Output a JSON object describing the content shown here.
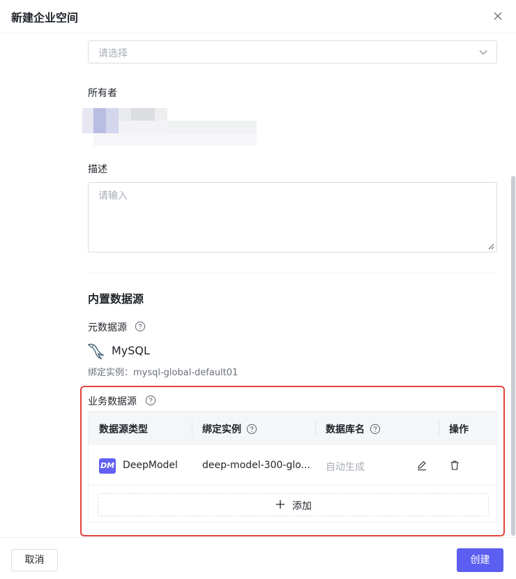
{
  "dialog": {
    "title": "新建企业空间"
  },
  "form": {
    "select_placeholder": "请选择",
    "owner_label": "所有者",
    "description_label": "描述",
    "description_placeholder": "请输入"
  },
  "builtin": {
    "section_title": "内置数据源",
    "meta_label": "元数据源",
    "meta_type": "MySQL",
    "bind_instance": "绑定实例：mysql-global-default01"
  },
  "business": {
    "label": "业务数据源",
    "columns": [
      "数据源类型",
      "绑定实例",
      "数据库名",
      "操作"
    ],
    "rows": [
      {
        "type": "DeepModel",
        "logo": "DM",
        "instance": "deep-model-300-glo...",
        "db_name": "自动生成"
      }
    ],
    "add_label": "添加"
  },
  "footer": {
    "cancel": "取消",
    "create": "创建"
  },
  "colors": {
    "primary": "#5b5ef0",
    "highlight_border": "#e5423b",
    "dm_logo": "#6260f0"
  }
}
